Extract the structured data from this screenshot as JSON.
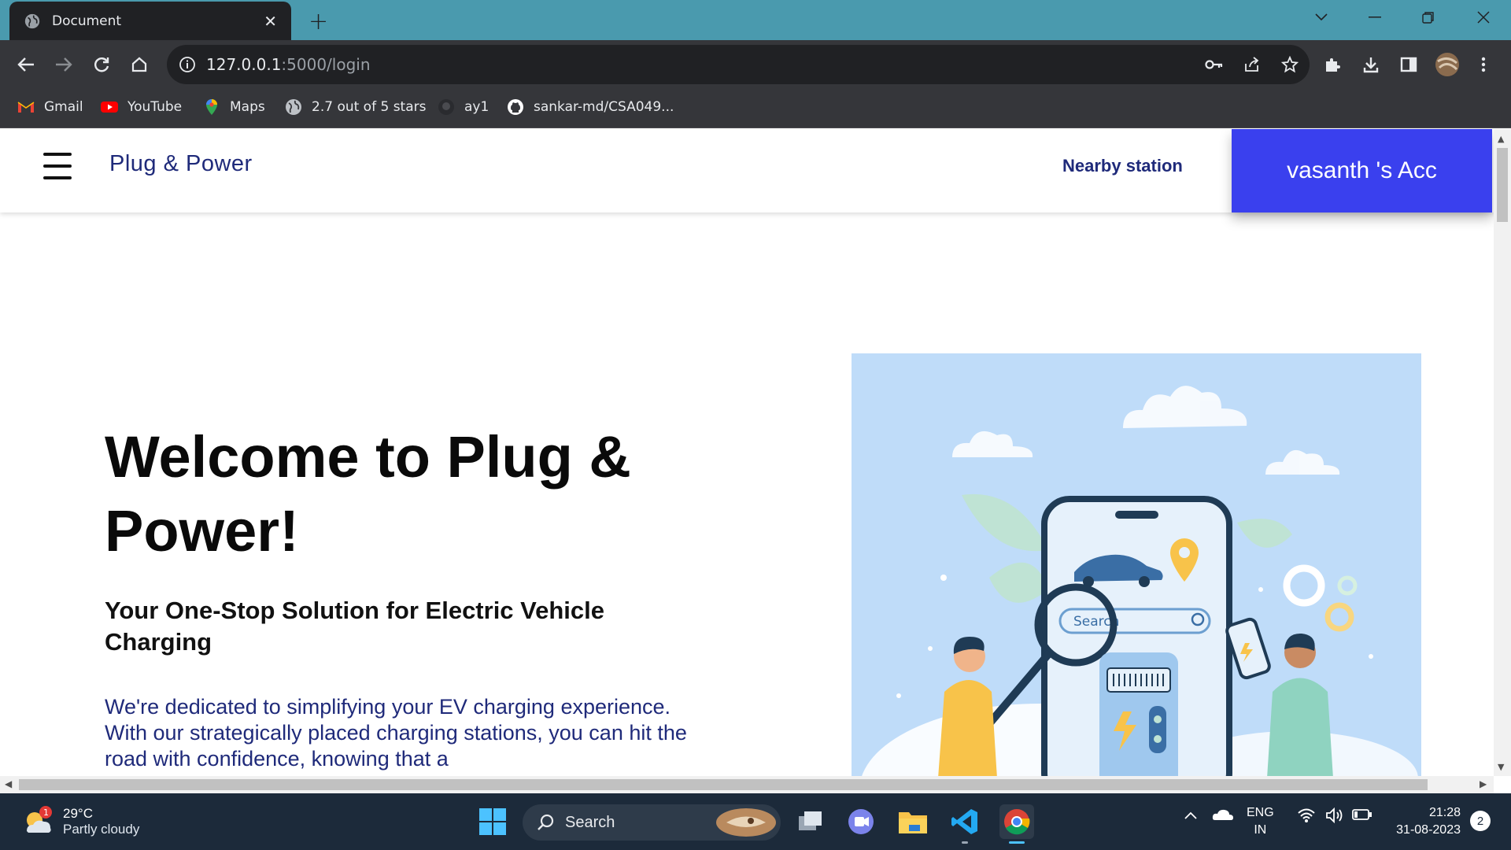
{
  "browser": {
    "tab_title": "Document",
    "tab_close": "✕",
    "new_tab": "+",
    "url_host": "127.0.0.1",
    "url_path": ":5000/login"
  },
  "bookmarks": [
    {
      "label": "Gmail"
    },
    {
      "label": "YouTube"
    },
    {
      "label": "Maps"
    },
    {
      "label": "2.7 out of 5 stars"
    },
    {
      "label": "ay1"
    },
    {
      "label": "sankar-md/CSA049..."
    }
  ],
  "nav": {
    "brand": "Plug & Power",
    "nearby": "Nearby station",
    "account": "vasanth 's Acc"
  },
  "hero": {
    "title": "Welcome to Plug & Power!",
    "subtitle": "Your One-Stop Solution for Electric Vehicle Charging",
    "body": "We're dedicated to simplifying your EV charging experience. With our strategically placed charging stations, you can hit the road with confidence, knowing that a"
  },
  "illustration": {
    "search_label": "Search"
  },
  "taskbar": {
    "weather_badge": "1",
    "temperature": "29°C",
    "condition": "Partly cloudy",
    "search_label": "Search",
    "lang_top": "ENG",
    "lang_bottom": "IN",
    "time": "21:28",
    "date": "31-08-2023",
    "notifications": "2"
  },
  "colors": {
    "tabbar": "#4a9aae",
    "chrome": "#35363a",
    "brand_text": "#1f2a7a",
    "account_bg": "#3a40ee",
    "illustration_bg": "#bfdcf9",
    "taskbar": "#1c2a3a"
  }
}
